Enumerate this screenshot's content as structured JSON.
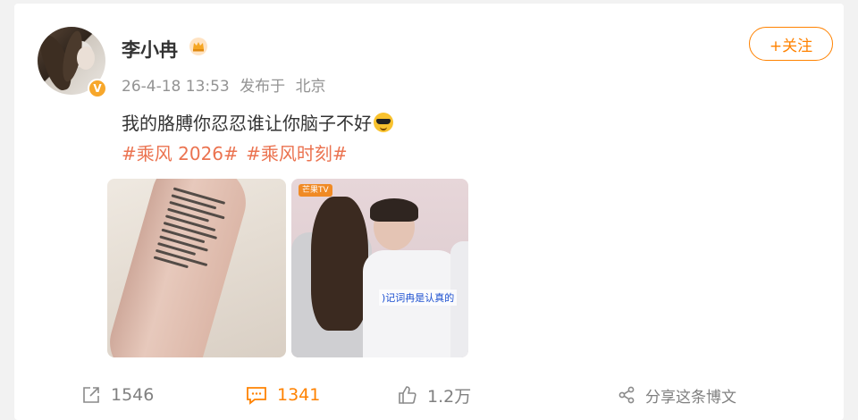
{
  "post": {
    "author": "李小冉",
    "time": "26-4-18 13:53",
    "source_prefix": "发布于",
    "location": "北京",
    "follow_label": "+关注",
    "text": "我的胳膊你忍忍谁让你脑子不好",
    "emoji": "cool-sunglasses-emoji",
    "tags": [
      "#乘风 2026#",
      "#乘风时刻#"
    ],
    "images": [
      {
        "name": "arm-with-lyrics-photo"
      },
      {
        "name": "stage-rehearsal-photo",
        "logo_text": "芒果TV",
        "subtitle": ")记词冉是认真的"
      }
    ]
  },
  "actions": {
    "repost_count": "1546",
    "comment_count": "1341",
    "like_count": "1.2万",
    "share_label": "分享这条博文"
  },
  "colors": {
    "accent": "#ff8200",
    "tag": "#eb7350",
    "muted": "#939393",
    "verified": "#f7a72b"
  }
}
